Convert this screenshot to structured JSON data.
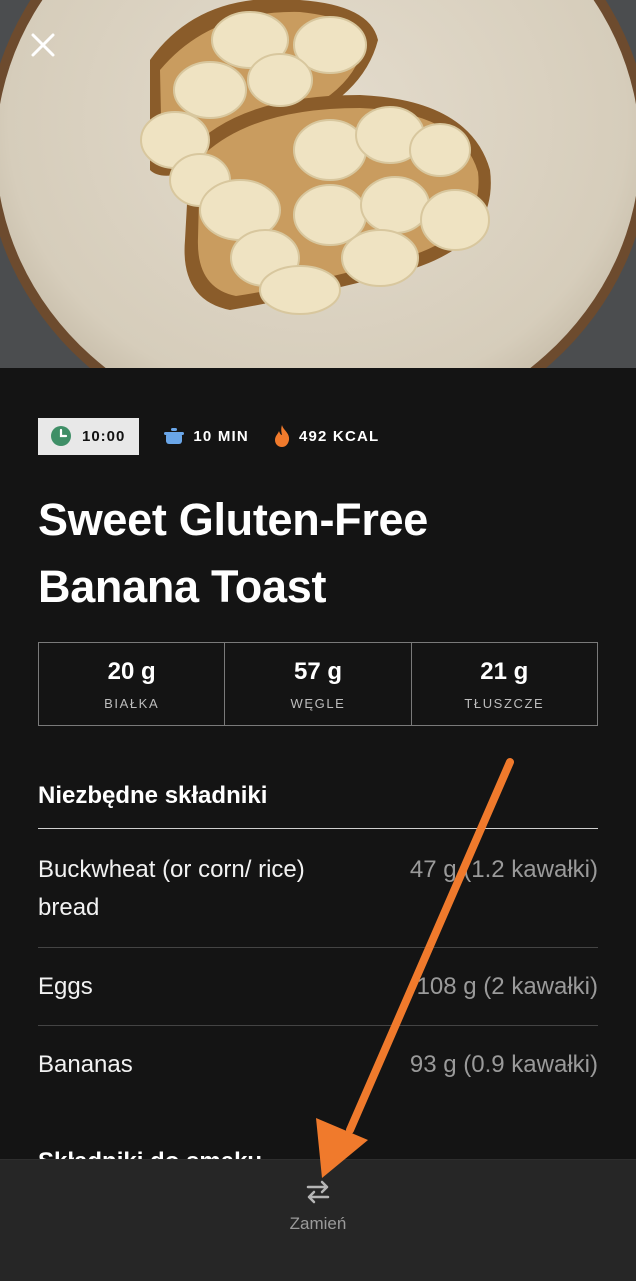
{
  "hero": {
    "image_alt": "Banana toast on a plate"
  },
  "meta": {
    "time": "10:00",
    "duration": "10 MIN",
    "calories": "492 KCAL"
  },
  "title": "Sweet Gluten-Free Banana Toast",
  "macros": [
    {
      "value": "20 g",
      "label": "BIAŁKA"
    },
    {
      "value": "57 g",
      "label": "WĘGLE"
    },
    {
      "value": "21 g",
      "label": "TŁUSZCZE"
    }
  ],
  "ingredients_title": "Niezbędne składniki",
  "ingredients": [
    {
      "name": "Buckwheat (or corn/ rice) bread",
      "qty": "47 g (1.2 kawałki)"
    },
    {
      "name": "Eggs",
      "qty": "108 g (2 kawałki)"
    },
    {
      "name": "Bananas",
      "qty": "93 g (0.9 kawałki)"
    }
  ],
  "next_section_title": "Składniki do smaku",
  "bottom_bar": {
    "swap_label": "Zamień"
  },
  "colors": {
    "background": "#141414",
    "accent_orange": "#f07a2c",
    "clock_green": "#3f8f67",
    "pot_blue": "#6aa6e8"
  },
  "icons": [
    "close-icon",
    "clock-icon",
    "pot-icon",
    "flame-icon",
    "swap-icon"
  ]
}
